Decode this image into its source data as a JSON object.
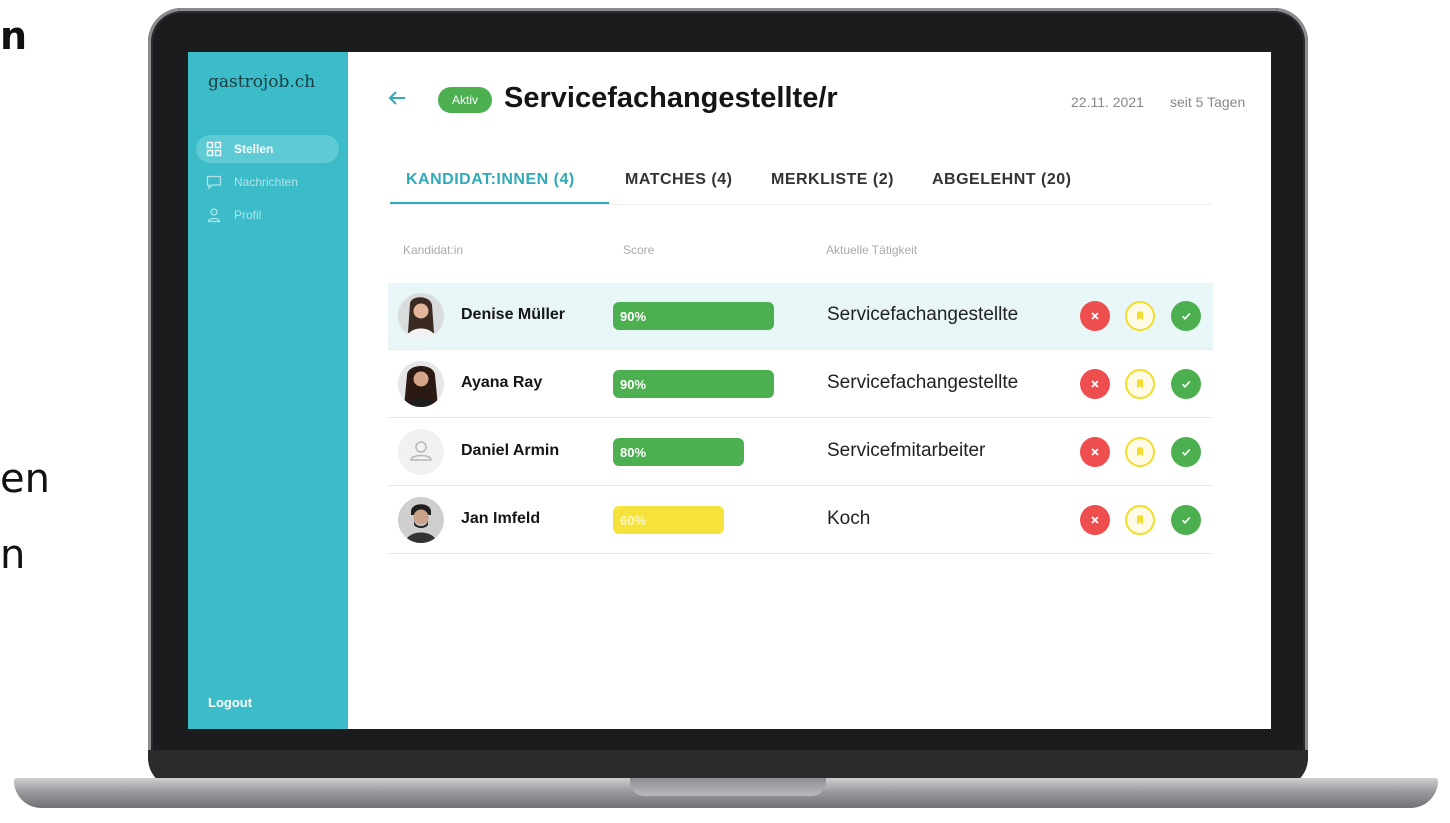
{
  "page_fragments": [
    "n",
    "en",
    "n"
  ],
  "app": {
    "brand": "gastrojob.ch"
  },
  "sidebar": {
    "items": [
      {
        "label": "Stellen",
        "icon": "grid-icon",
        "active": true
      },
      {
        "label": "Nachrichten",
        "icon": "message-icon",
        "active": false
      },
      {
        "label": "Profil",
        "icon": "user-icon",
        "active": false
      }
    ],
    "logout": "Logout"
  },
  "header": {
    "status_badge": "Aktiv",
    "title": "Servicefachangestellte/r",
    "date": "22.11. 2021",
    "since": "seit 5 Tagen"
  },
  "tabs": [
    {
      "label": "KANDIDAT:INNEN (4)",
      "active": true
    },
    {
      "label": "MATCHES (4)",
      "active": false
    },
    {
      "label": "MERKLISTE (2)",
      "active": false
    },
    {
      "label": "ABGELEHNT (20)",
      "active": false
    }
  ],
  "table": {
    "columns": [
      "Kandidat:in",
      "Score",
      "Aktuelle Tätigkeit"
    ],
    "rows": [
      {
        "name": "Denise Müller",
        "score": 90,
        "score_label": "90%",
        "job": "Servicefachangestellte",
        "avatar": "photo"
      },
      {
        "name": "Ayana Ray",
        "score": 90,
        "score_label": "90%",
        "job": "Servicefachangestellte",
        "avatar": "photo"
      },
      {
        "name": "Daniel Armin",
        "score": 80,
        "score_label": "80%",
        "job": "Servicefmitarbeiter",
        "avatar": "placeholder"
      },
      {
        "name": "Jan Imfeld",
        "score": 60,
        "score_label": "60%",
        "job": "Koch",
        "avatar": "photo"
      }
    ]
  },
  "colors": {
    "sidebar": "#3bbcc8",
    "accent": "#30aab7",
    "score_high": "#4caf50",
    "score_mid": "#f5e33b",
    "reject": "#ef4e4e",
    "accept": "#4caf50"
  }
}
